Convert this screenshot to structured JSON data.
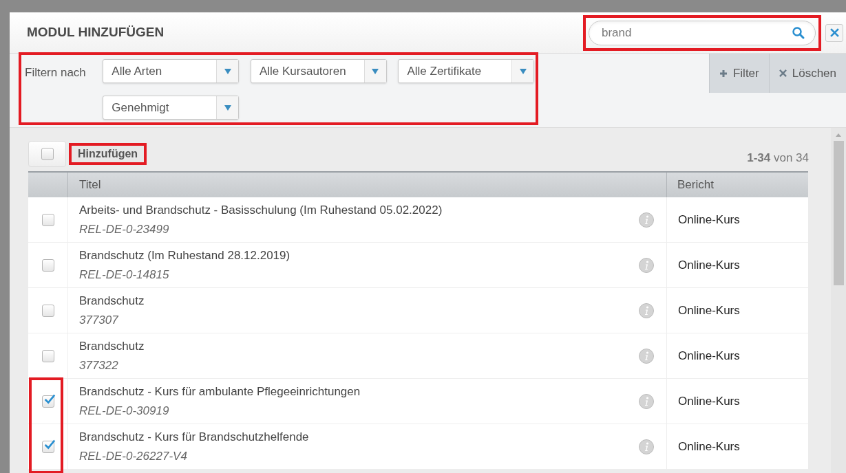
{
  "dialog": {
    "title": "MODUL HINZUFÜGEN"
  },
  "search": {
    "value": "brand",
    "highlighted": true
  },
  "filter_bar": {
    "label": "Filtern nach",
    "highlighted": true,
    "dropdowns": [
      {
        "value": "Alle Arten"
      },
      {
        "value": "Alle Kursautoren"
      },
      {
        "value": "Alle Zertifikate"
      },
      {
        "value": "Genehmigt"
      }
    ],
    "buttons": [
      {
        "kind": "add",
        "label": "Filter"
      },
      {
        "kind": "clear",
        "label": "Löschen"
      }
    ]
  },
  "toolbar": {
    "select_all": {
      "checked": false
    },
    "add_button": {
      "label": "Hinzufügen",
      "highlighted": true
    },
    "range": "1-34",
    "count": "von 34"
  },
  "table": {
    "columns": [
      "Titel",
      "Bericht"
    ],
    "rows": [
      {
        "title": "Arbeits- und Brandschutz - Basisschulung (Im Ruhestand 05.02.2022)",
        "code": "REL-DE-0-23499",
        "report": "Online-Kurs",
        "checked": false,
        "highlighted": false
      },
      {
        "title": "Brandschutz (Im Ruhestand 28.12.2019)",
        "code": "REL-DE-0-14815",
        "report": "Online-Kurs",
        "checked": false,
        "highlighted": false
      },
      {
        "title": "Brandschutz",
        "code": "377307",
        "report": "Online-Kurs",
        "checked": false,
        "highlighted": false
      },
      {
        "title": "Brandschutz",
        "code": "377322",
        "report": "Online-Kurs",
        "checked": false,
        "highlighted": false
      },
      {
        "title": "Brandschutz - Kurs für ambulante Pflegeeinrichtungen",
        "code": "REL-DE-0-30919",
        "report": "Online-Kurs",
        "checked": true,
        "highlighted": true
      },
      {
        "title": "Brandschutz - Kurs für Brandschutzhelfende",
        "code": "REL-DE-0-26227-V4",
        "report": "Online-Kurs",
        "checked": true,
        "highlighted": true
      }
    ]
  }
}
